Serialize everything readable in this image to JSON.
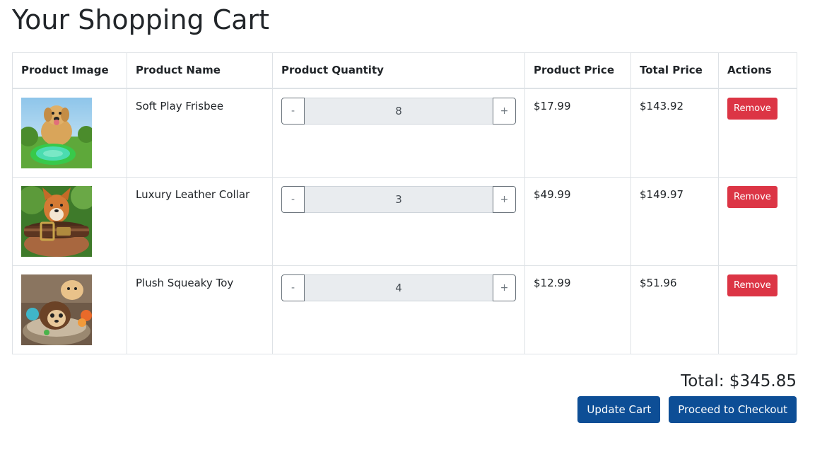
{
  "page": {
    "title": "Your Shopping Cart"
  },
  "table": {
    "headers": [
      "Product Image",
      "Product Name",
      "Product Quantity",
      "Product Price",
      "Total Price",
      "Actions"
    ],
    "rows": [
      {
        "name": "Soft Play Frisbee",
        "quantity": "8",
        "price": "$17.99",
        "total": "$143.92",
        "image": "dog-with-frisbee-photo"
      },
      {
        "name": "Luxury Leather Collar",
        "quantity": "3",
        "price": "$49.99",
        "total": "$149.97",
        "image": "dog-with-leather-collar-photo"
      },
      {
        "name": "Plush Squeaky Toy",
        "quantity": "4",
        "price": "$12.99",
        "total": "$51.96",
        "image": "plush-hedgehog-toy-photo"
      }
    ]
  },
  "controls": {
    "decrement": "-",
    "increment": "+",
    "remove": "Remove"
  },
  "summary": {
    "total": "Total: $345.85"
  },
  "buttons": {
    "update": "Update Cart",
    "checkout": "Proceed to Checkout"
  },
  "colors": {
    "danger": "#dc3545",
    "primary": "#0d4e96",
    "text": "#212529",
    "border": "#dee2e6"
  }
}
